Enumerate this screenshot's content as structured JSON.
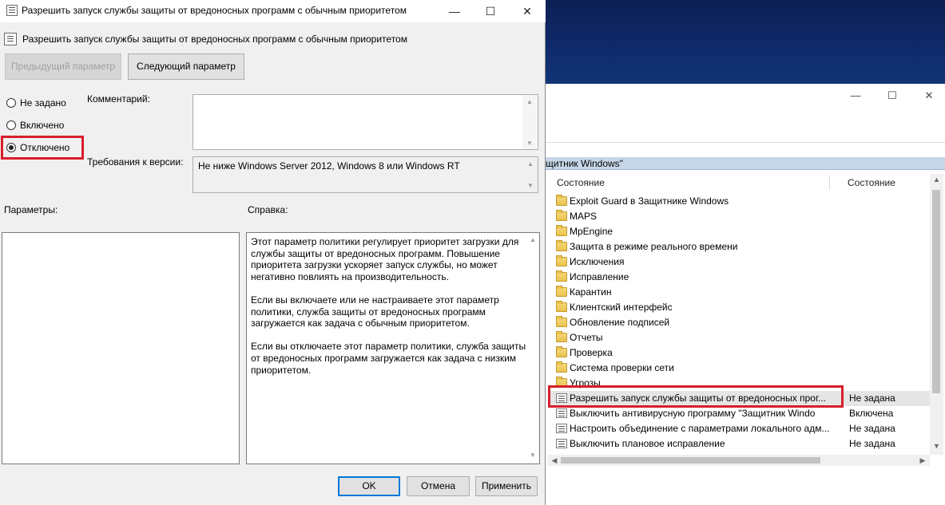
{
  "dialog": {
    "title": "Разрешить запуск службы защиты от вредоносных программ с обычным приоритетом",
    "header": "Разрешить запуск службы защиты от вредоносных программ с обычным приоритетом",
    "controls": {
      "minimize": "—",
      "maximize": "☐",
      "close": "✕"
    },
    "buttons": {
      "prev": "Предыдущий параметр",
      "next": "Следующий параметр",
      "ok": "OK",
      "cancel": "Отмена",
      "apply": "Применить"
    },
    "options": [
      {
        "label": "Не задано",
        "selected": false
      },
      {
        "label": "Включено",
        "selected": false
      },
      {
        "label": "Отключено",
        "selected": true
      }
    ],
    "comment_label": "Комментарий:",
    "comment_value": "",
    "version_label": "Требования к версии:",
    "version_value": "Не ниже Windows Server 2012, Windows 8 или Windows RT",
    "params_label": "Параметры:",
    "help_label": "Справка:",
    "help_paragraphs": [
      "Этот параметр политики регулирует приоритет загрузки для\nслужбы защиты от вредоносных программ. Повышение\nприоритета загрузки ускоряет запуск службы, но может\nнегативно повлиять на производительность.",
      "Если вы включаете или не настраиваете этот параметр\nполитики, служба защиты от вредоносных программ\nзагружается как задача с обычным приоритетом.",
      "Если вы отключаете этот параметр политики, служба защиты\nот вредоносных программ загружается как задача с низким\nприоритетом."
    ]
  },
  "background_window": {
    "controls": {
      "minimize": "—",
      "maximize": "☐",
      "close": "✕"
    },
    "path_fragment": "щитник Windows\"",
    "columns": [
      "Состояние",
      "Состояние"
    ],
    "rows": [
      {
        "type": "folder",
        "name": "Exploit Guard в Защитнике Windows",
        "state": ""
      },
      {
        "type": "folder",
        "name": "MAPS",
        "state": ""
      },
      {
        "type": "folder",
        "name": "MpEngine",
        "state": ""
      },
      {
        "type": "folder",
        "name": "Защита в режиме реального времени",
        "state": ""
      },
      {
        "type": "folder",
        "name": "Исключения",
        "state": ""
      },
      {
        "type": "folder",
        "name": "Исправление",
        "state": ""
      },
      {
        "type": "folder",
        "name": "Карантин",
        "state": ""
      },
      {
        "type": "folder",
        "name": "Клиентский интерфейс",
        "state": ""
      },
      {
        "type": "folder",
        "name": "Обновление подписей",
        "state": ""
      },
      {
        "type": "folder",
        "name": "Отчеты",
        "state": ""
      },
      {
        "type": "folder",
        "name": "Проверка",
        "state": ""
      },
      {
        "type": "folder",
        "name": "Система проверки сети",
        "state": ""
      },
      {
        "type": "folder",
        "name": "Угрозы",
        "state": ""
      },
      {
        "type": "policy",
        "name": "Разрешить запуск службы защиты от вредоносных прог...",
        "state": "Не задана",
        "selected": true
      },
      {
        "type": "policy",
        "name": "Выключить антивирусную программу \"Защитник Windo",
        "state": "Включена"
      },
      {
        "type": "policy",
        "name": "Настроить объединение с параметрами локального адм...",
        "state": "Не задана"
      },
      {
        "type": "policy",
        "name": "Выключить плановое исправление",
        "state": "Не задана"
      }
    ]
  },
  "colors": {
    "highlight_red": "#d71f2a",
    "desktop_blue": "#0f2a6b",
    "path_bar": "#c7d7e8",
    "focus_blue": "#0078d7"
  }
}
